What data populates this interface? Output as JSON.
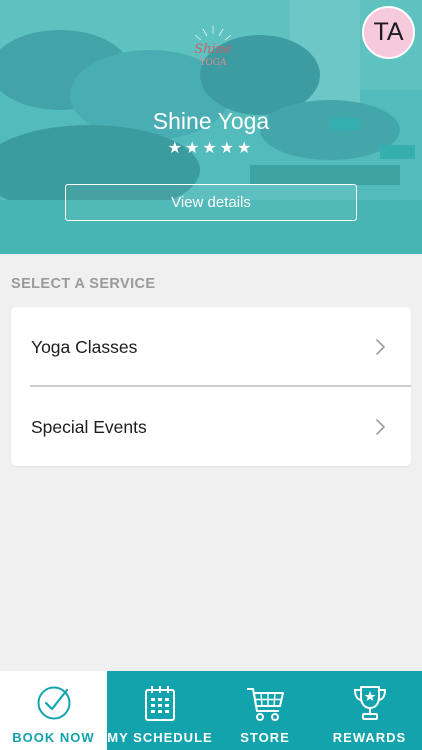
{
  "colors": {
    "accent": "#12a3ad",
    "hero_tint": "#49b0b0",
    "avatar_bg": "#f6c9dc",
    "background": "#f0f0f0"
  },
  "header": {
    "logo_icon": "shine-yoga-logo",
    "studio_name": "Shine Yoga",
    "rating": 5,
    "rating_text": "★★★★★",
    "view_details_label": "View details",
    "avatar_initials": "TA"
  },
  "services": {
    "section_title": "SELECT A SERVICE",
    "items": [
      {
        "label": "Yoga Classes",
        "icon": "chevron-right-icon"
      },
      {
        "label": "Special Events",
        "icon": "chevron-right-icon"
      }
    ]
  },
  "tabbar": {
    "tabs": [
      {
        "label": "BOOK NOW",
        "icon": "checkmark-circle-icon",
        "active": true
      },
      {
        "label": "MY SCHEDULE",
        "icon": "calendar-icon",
        "active": false
      },
      {
        "label": "STORE",
        "icon": "shopping-cart-icon",
        "active": false
      },
      {
        "label": "REWARDS",
        "icon": "trophy-icon",
        "active": false
      }
    ]
  }
}
